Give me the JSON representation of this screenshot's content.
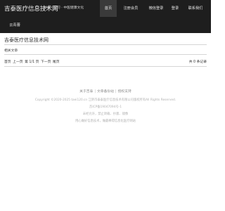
{
  "header": {
    "brand": "吉泰医疗信息技术网",
    "tagline": "共享 · 学习 · 中医健康文化",
    "nav": [
      {
        "label": "首页",
        "active": true
      },
      {
        "label": "注册会员",
        "active": false
      },
      {
        "label": "微信登录",
        "active": false
      },
      {
        "label": "登录",
        "active": false
      },
      {
        "label": "联系我们",
        "active": false
      },
      {
        "label": "云青蕾",
        "active": false
      }
    ]
  },
  "main": {
    "site_title": "吉泰医疗信息技术网",
    "section_label": "相关文章",
    "pager": {
      "first": "首页",
      "prev": "上一页",
      "pages": "第 1/1 页",
      "next": "下一页",
      "last": "尾页",
      "count": "共 0 条记录"
    }
  },
  "footer": {
    "links": [
      "关于吉泰",
      "文章备份站",
      "授权支持"
    ],
    "copyright": "Copyright ©2020-2025 taei120.cn 江阴市泰泰医疗信息技术有限公司版权所有All Rights Reserved.",
    "icp": "苏ICP备19047094号-1",
    "notice1": "未经允许，禁止转载、抄袭、镜像",
    "notice2": "用心做好信息技术，做最棒得信息化医疗网站"
  }
}
